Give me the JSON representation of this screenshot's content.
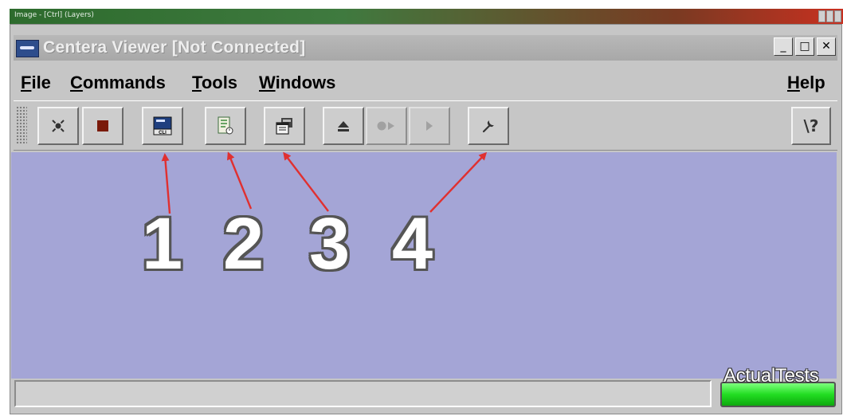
{
  "outer_window": {
    "title": "Image - [Ctrl] (Layers)"
  },
  "window": {
    "title": "Centera Viewer [Not Connected]",
    "controls": {
      "minimize": "_",
      "maximize": "□",
      "close": "✕"
    }
  },
  "menu": {
    "file": "File",
    "commands": "Commands",
    "tools": "Tools",
    "windows": "Windows",
    "help": "Help"
  },
  "toolbar": {
    "buttons": [
      {
        "icon": "connect-icon",
        "enabled": true
      },
      {
        "icon": "stop-icon",
        "enabled": true
      },
      {
        "icon": "cli-icon",
        "label": "CLI",
        "enabled": true
      },
      {
        "icon": "monitor-icon",
        "enabled": true
      },
      {
        "icon": "properties-icon",
        "enabled": true
      },
      {
        "icon": "eject-icon",
        "enabled": true
      },
      {
        "icon": "record-icon",
        "enabled": false
      },
      {
        "icon": "play-icon",
        "enabled": false
      },
      {
        "icon": "wrench-icon",
        "enabled": true
      },
      {
        "icon": "context-help-icon",
        "label": "\\?",
        "enabled": true
      }
    ]
  },
  "annotations": [
    "1",
    "2",
    "3",
    "4"
  ],
  "watermark": "ActualTests",
  "colors": {
    "content_bg": "#a4a5d6",
    "chrome_bg": "#c6c6c6",
    "arrow": "#e03030",
    "status_led": "#22dd22"
  }
}
